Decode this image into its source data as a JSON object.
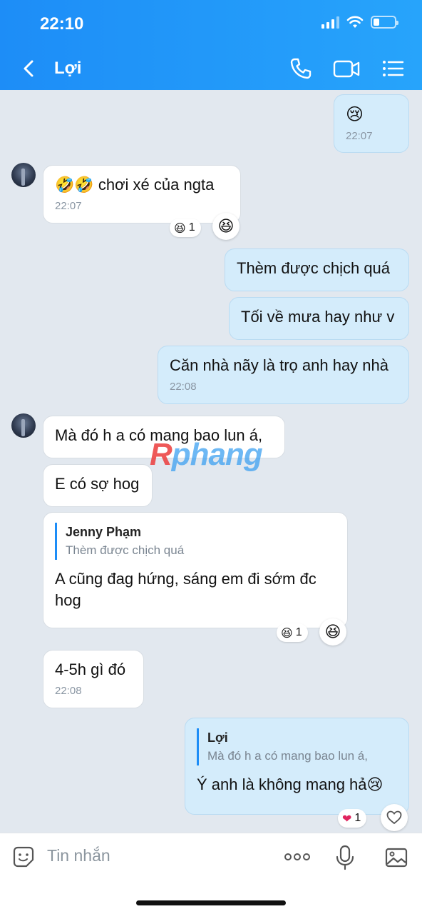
{
  "status_bar": {
    "time": "22:10"
  },
  "header": {
    "title": "Lợi"
  },
  "messages": {
    "m1": {
      "emoji": "😢",
      "time": "22:07"
    },
    "m2": {
      "text": "🤣🤣 chơi xé của ngta",
      "time": "22:07",
      "reaction_emoji": "😆",
      "reaction_count": "1"
    },
    "m3": {
      "text": "Thèm được chịch quá"
    },
    "m4": {
      "text": "Tối về mưa hay như v"
    },
    "m5": {
      "text": "Căn nhà nãy là trọ anh hay nhà",
      "time": "22:08"
    },
    "m6": {
      "text": "Mà đó h a có mang bao lun á,"
    },
    "m7": {
      "text": "E có sợ hog"
    },
    "m8": {
      "quote_name": "Jenny Phạm",
      "quote_text": "Thèm được chịch quá",
      "text": "A cũng đag hứng, sáng em đi sớm đc hog",
      "reaction_emoji": "😆",
      "reaction_count": "1"
    },
    "m9": {
      "text": "4-5h gì đó",
      "time": "22:08"
    },
    "m10": {
      "quote_name": "Lợi",
      "quote_text": "Mà đó h a có mang bao lun á,",
      "text": "Ý anh là không mang hả😢",
      "reaction_emoji": "❤",
      "reaction_count": "1"
    }
  },
  "watermark": {
    "first": "R",
    "rest": "phang"
  },
  "input": {
    "placeholder": "Tin nhắn"
  },
  "icons": {
    "back": "chevron-left-icon",
    "call": "phone-icon",
    "video": "video-camera-icon",
    "menu": "list-menu-icon",
    "sticker": "sticker-icon",
    "more": "more-dots-icon",
    "mic": "microphone-icon",
    "gallery": "image-icon",
    "heart": "heart-icon"
  },
  "colors": {
    "header": "#1d8df7",
    "sent_bubble": "#d4ecfb",
    "received_bubble": "#ffffff",
    "background": "#e2e8ef"
  }
}
